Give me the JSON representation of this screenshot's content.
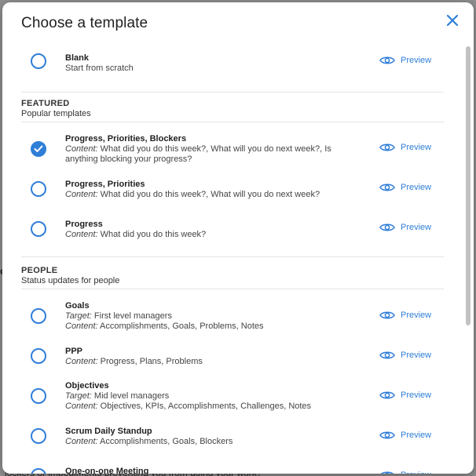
{
  "modal": {
    "title": "Choose a template",
    "close_icon": "close-icon"
  },
  "colors": {
    "accent": "#2f7ed8",
    "divider": "#e3e3e3"
  },
  "preview_label": "Preview",
  "blank": {
    "name": "Blank",
    "description": "Start from scratch",
    "selected": false
  },
  "featured": {
    "title": "FEATURED",
    "subtitle": "Popular templates",
    "items": [
      {
        "name": "Progress, Priorities, Blockers",
        "content_label": "Content:",
        "content_line1": "What did you do this week?, What will you do next week?, Is",
        "content_line2": "anything blocking your progress?",
        "selected": true
      },
      {
        "name": "Progress, Priorities",
        "content_label": "Content:",
        "content": "What did you do this week?, What will you do next week?",
        "selected": false
      },
      {
        "name": "Progress",
        "content_label": "Content:",
        "content": "What did you do this week?",
        "selected": false
      }
    ]
  },
  "people": {
    "title": "PEOPLE",
    "subtitle": "Status updates for people",
    "items": [
      {
        "name": "Goals",
        "target_label": "Target:",
        "target": "First level managers",
        "content_label": "Content:",
        "content": "Accomplishments, Goals, Problems, Notes",
        "selected": false
      },
      {
        "name": "PPP",
        "content_label": "Content:",
        "content": "Progress, Plans, Problems",
        "selected": false
      },
      {
        "name": "Objectives",
        "target_label": "Target:",
        "target": "Mid level managers",
        "content_label": "Content:",
        "content": "Objectives, KPIs, Accomplishments, Challenges, Notes",
        "selected": false
      },
      {
        "name": "Scrum Daily Standup",
        "content_label": "Content:",
        "content": "Accomplishments, Goals, Blockers",
        "selected": false
      },
      {
        "name": "One-on-one Meeting",
        "selected": false
      }
    ]
  },
  "backdrop": {
    "partial_text": "lockers or impediments preventing you from doing your work?"
  }
}
